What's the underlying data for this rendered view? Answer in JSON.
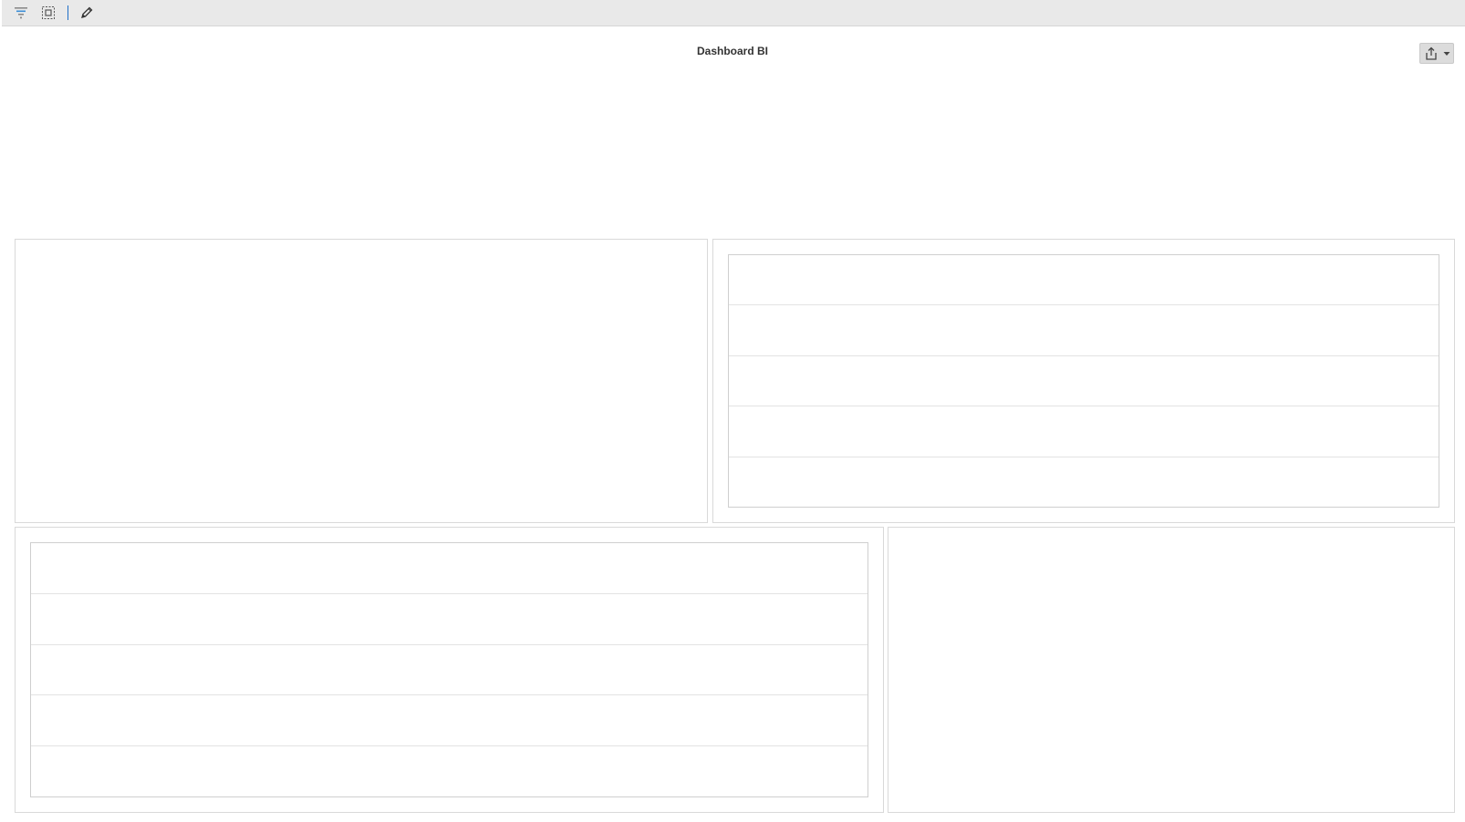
{
  "toolbar": {
    "items": [
      {
        "name": "filter-icon",
        "tooltip": ""
      },
      {
        "name": "select-all-icon",
        "tooltip": ""
      },
      {
        "name": "edit-pencil-icon",
        "tooltip": ""
      }
    ]
  },
  "dashboard": {
    "title": "Dashboard BI"
  },
  "export": {
    "icon": "share-export-icon",
    "caret": "caret-down-icon"
  },
  "colors": {
    "toolbar_bg": "#e9e9e9",
    "border": "#d9d9d9",
    "accent": "#1e6fc8",
    "title": "#333333"
  }
}
